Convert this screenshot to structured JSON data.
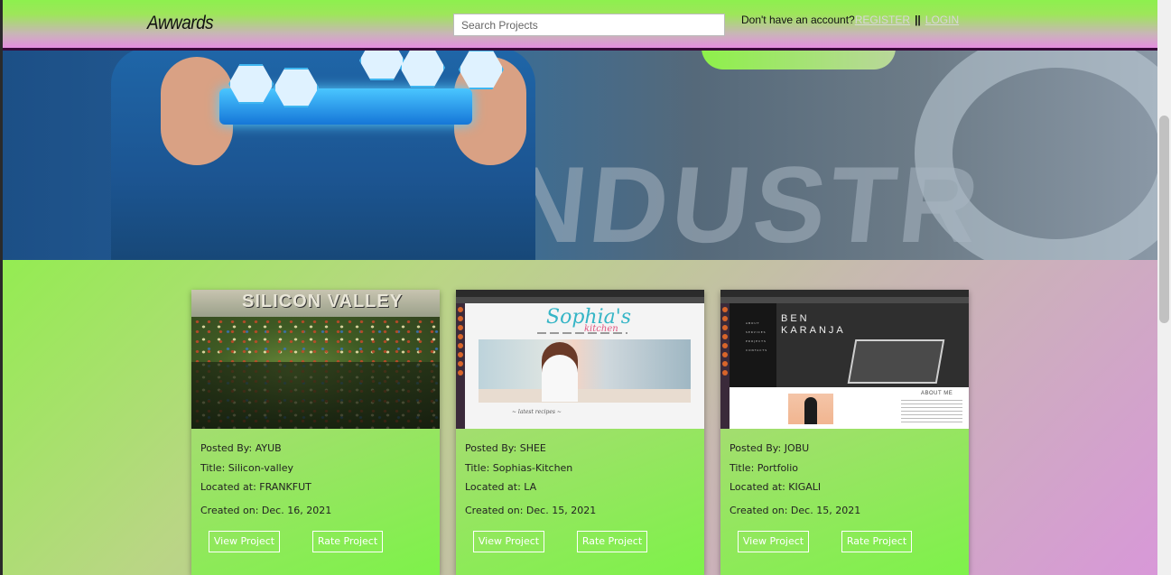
{
  "navbar": {
    "brand": "Awwards",
    "search_placeholder": "Search Projects",
    "auth_prompt": "Don't have an account?",
    "register_label": "REGISTER",
    "separator": "||",
    "login_label": "LOGIN"
  },
  "hero": {
    "background_text": "NDUSTR"
  },
  "thumbnails": {
    "silicon_title": "SILICON VALLEY",
    "sophia_logo": "Sophia's",
    "sophia_logo_sub": "kitchen",
    "sophia_tag": "~ latest recipes ~",
    "ben_name_1": "BEN",
    "ben_name_2": "KARANJA",
    "ben_about": "ABOUT ME",
    "ben_menu": [
      "ABOUT",
      "SERVICES",
      "PROJECTS",
      "CONTACTS"
    ]
  },
  "projects": [
    {
      "posted_by": "Posted By: AYUB",
      "title": "Title: Silicon-valley",
      "location": "Located at: FRANKFUT",
      "created": "Created on: Dec. 16, 2021",
      "view_label": "View Project",
      "rate_label": "Rate Project"
    },
    {
      "posted_by": "Posted By: SHEE",
      "title": "Title: Sophias-Kitchen",
      "location": "Located at: LA",
      "created": "Created on: Dec. 15, 2021",
      "view_label": "View Project",
      "rate_label": "Rate Project"
    },
    {
      "posted_by": "Posted By: JOBU",
      "title": "Title: Portfolio",
      "location": "Located at: KIGALI",
      "created": "Created on: Dec. 15, 2021",
      "view_label": "View Project",
      "rate_label": "Rate Project"
    }
  ],
  "colors": {
    "nav_green": "#8df04e",
    "nav_pink": "#e48ee0",
    "card_green": "#7ef24a"
  }
}
